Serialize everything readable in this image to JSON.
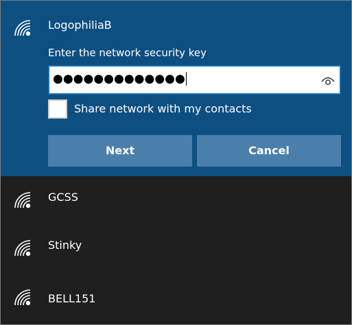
{
  "selected_network": {
    "ssid": "LogophiliaB",
    "icon": "wifi-secured-icon",
    "prompt": "Enter the network security key",
    "key_masked": "●●●●●●●●●●●●●",
    "reveal_icon": "eye-icon",
    "share_checked": false,
    "share_label": "Share network with my contacts",
    "next_label": "Next",
    "cancel_label": "Cancel"
  },
  "networks": [
    {
      "ssid": "GCSS",
      "icon": "wifi-secured-icon"
    },
    {
      "ssid": "Stinky",
      "icon": "wifi-secured-icon"
    },
    {
      "ssid": "BELL151",
      "icon": "wifi-secured-icon"
    }
  ],
  "colors": {
    "accent_panel": "#0e4f82",
    "button_bg": "#4a7fab",
    "list_bg": "#1f1f1f",
    "text": "#ffffff"
  }
}
